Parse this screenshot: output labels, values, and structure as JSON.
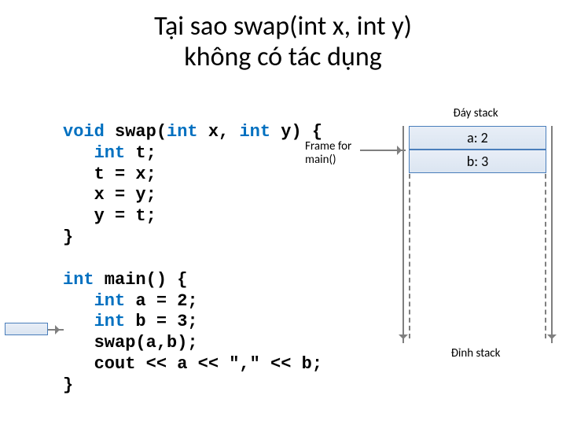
{
  "title_line1": "Tại sao swap(int x, int y)",
  "title_line2": "không có tác dụng",
  "stack": {
    "top_label": "Đáy stack",
    "bottom_label": "Đỉnh stack",
    "cells": [
      {
        "text": "a: 2"
      },
      {
        "text": "b: 3"
      }
    ]
  },
  "frame_label_line1": "Frame for",
  "frame_label_line2": "main()",
  "code": {
    "swap": {
      "void": "void",
      "name": " swap(",
      "int1": "int",
      "gap1": " x, ",
      "int2": "int",
      "gap2": " y) {",
      "l1a": "   ",
      "l1_int": "int",
      "l1b": " t;",
      "l2": "   t = x;",
      "l3": "   x = y;",
      "l4": "   y = t;",
      "close": "}"
    },
    "main": {
      "sig_int": "int",
      "sig_rest": " main() {",
      "l1a": "   ",
      "l1_int": "int",
      "l1b": " a = 2;",
      "l2a": "   ",
      "l2_int": "int",
      "l2b": " b = 3;",
      "l3": "   swap(a,b);",
      "l4": "   cout << a << \",\" << b;",
      "close": "}"
    }
  }
}
